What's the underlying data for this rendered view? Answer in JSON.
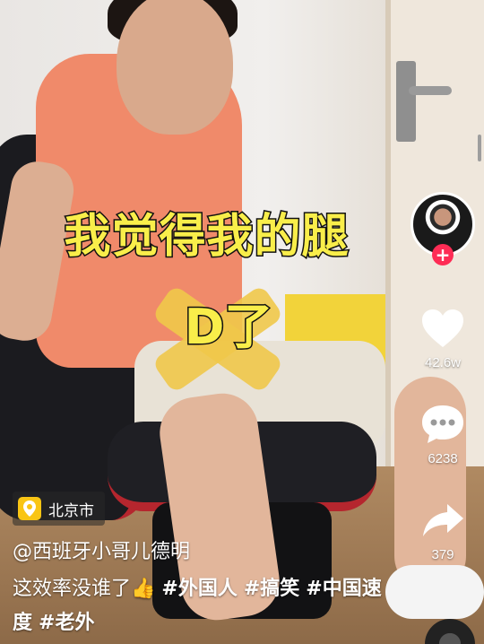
{
  "video": {
    "caption_line1": "我觉得我的腿",
    "caption_line2": "D了"
  },
  "rail": {
    "follow_symbol": "+",
    "like_count": "42.6w",
    "comment_count": "6238",
    "share_count": "379"
  },
  "info": {
    "location": "北京市",
    "author": "@西班牙小哥儿德明",
    "description": "这效率没谁了👍 ",
    "tags": [
      "#外国人",
      "#搞笑",
      "#中国速度",
      "#老外"
    ]
  },
  "colors": {
    "accent_follow": "#fe2c55",
    "caption_yellow": "#f9ee4a",
    "poi_yellow": "#f9c514"
  },
  "icons": [
    "heart-icon",
    "comment-bubble-icon",
    "share-arrow-icon",
    "location-pin-icon",
    "plus-icon",
    "music-disc-icon"
  ]
}
